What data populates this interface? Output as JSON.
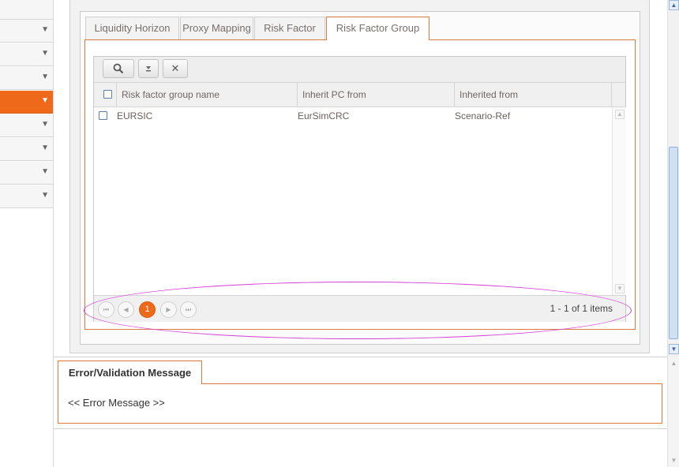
{
  "sidebar": {
    "items": [
      {
        "arrow": "▼"
      },
      {
        "arrow": "▼"
      },
      {
        "arrow": "▼"
      },
      {
        "arrow": "▼"
      },
      {
        "arrow": "▼"
      },
      {
        "arrow": "▼"
      },
      {
        "arrow": "▼"
      },
      {
        "arrow": "▼"
      }
    ],
    "active_index": 3
  },
  "tabs": [
    {
      "label": "Liquidity Horizon"
    },
    {
      "label": "Proxy Mapping"
    },
    {
      "label": "Risk Factor"
    },
    {
      "label": "Risk Factor Group"
    }
  ],
  "toolbar": {
    "search_glyph": "🔍",
    "export_glyph": "▾",
    "clear_glyph": "✕"
  },
  "grid": {
    "columns": [
      "Risk factor group name",
      "Inherit PC from",
      "Inherited from"
    ],
    "rows": [
      {
        "name": "EURSIC",
        "inherit": "EurSimCRC",
        "inherited_from": "Scenario-Ref"
      }
    ]
  },
  "pager": {
    "first": "⏮",
    "prev": "◀",
    "current": "1",
    "next": "▶",
    "last": "⏭",
    "info": "1 - 1 of 1 items"
  },
  "error": {
    "tab_label": "Error/Validation Message",
    "message": "<< Error Message >>"
  },
  "colors": {
    "accent": "#ee6a1a",
    "annotation": "#d640d6"
  }
}
